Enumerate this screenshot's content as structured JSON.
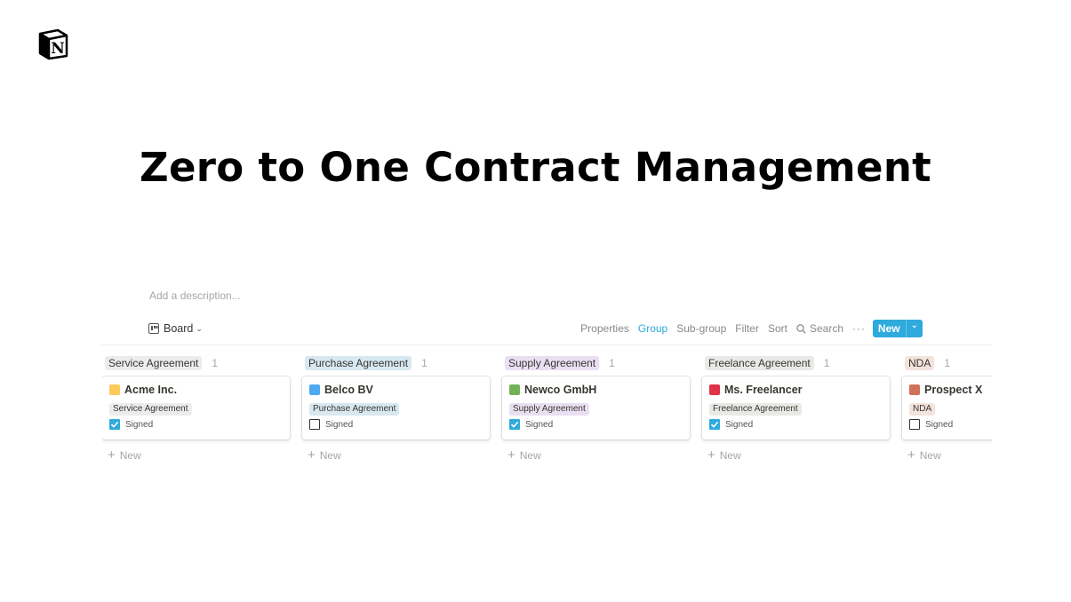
{
  "page": {
    "title": "Zero to One Contract Management",
    "description_placeholder": "Add a description..."
  },
  "toolbar": {
    "view_label": "Board",
    "actions": {
      "properties": "Properties",
      "group": "Group",
      "subgroup": "Sub-group",
      "filter": "Filter",
      "sort": "Sort",
      "search": "Search",
      "more": "···"
    },
    "new_label": "New",
    "accent_color": "#2eaadc"
  },
  "board": {
    "signed_label": "Signed",
    "add_new_label": "New",
    "columns": [
      {
        "group": "Service Agreement",
        "count": "1",
        "pill_color": "#ebeced",
        "card": {
          "title": "Acme Inc.",
          "swatch_color": "#fdc95b",
          "tag": "Service Agreement",
          "signed": true
        }
      },
      {
        "group": "Purchase Agreement",
        "count": "1",
        "pill_color": "#d8e8f1",
        "card": {
          "title": "Belco BV",
          "swatch_color": "#4daaf0",
          "tag": "Purchase Agreement",
          "signed": false
        }
      },
      {
        "group": "Supply Agreement",
        "count": "1",
        "pill_color": "#eadff2",
        "card": {
          "title": "Newco GmbH",
          "swatch_color": "#71b256",
          "tag": "Supply Agreement",
          "signed": true
        }
      },
      {
        "group": "Freelance Agreement",
        "count": "1",
        "pill_color": "#e9e9e7",
        "card": {
          "title": "Ms. Freelancer",
          "swatch_color": "#e03146",
          "tag": "Freelance Agreement",
          "signed": true
        }
      },
      {
        "group": "NDA",
        "count": "1",
        "pill_color": "#f3e3dd",
        "card": {
          "title": "Prospect X",
          "swatch_color": "#d0715a",
          "tag": "NDA",
          "signed": false
        }
      }
    ]
  }
}
